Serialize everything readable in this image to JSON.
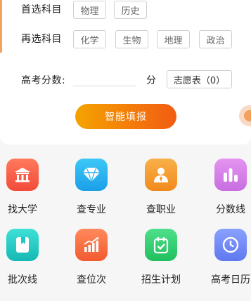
{
  "form": {
    "first_subject_label": "首选科目",
    "first_subject_options": [
      "物理",
      "历史"
    ],
    "second_subject_label": "再选科目",
    "second_subject_options": [
      "化学",
      "生物",
      "地理",
      "政治"
    ],
    "score_label": "高考分数:",
    "score_value": "",
    "score_unit": "分",
    "wishlist_label": "志愿表（0）",
    "submit_label": "智能填报"
  },
  "menu": {
    "items": [
      {
        "label": "找大学",
        "icon": "university-icon",
        "color": "#f55a4a"
      },
      {
        "label": "查专业",
        "icon": "diamond-icon",
        "color": "#28b6f0"
      },
      {
        "label": "查职业",
        "icon": "profession-icon",
        "color": "#f59a2e"
      },
      {
        "label": "分数线",
        "icon": "bar-chart-icon",
        "color": "#d67be8"
      },
      {
        "label": "批次线",
        "icon": "bookmark-icon",
        "color": "#1ec9c4"
      },
      {
        "label": "查位次",
        "icon": "rank-chart-icon",
        "color": "#f56b3d"
      },
      {
        "label": "招生计划",
        "icon": "calendar-check-icon",
        "color": "#2fcf6a"
      },
      {
        "label": "高考日历",
        "icon": "clock-icon",
        "color": "#6c86f5"
      }
    ]
  },
  "colors": {
    "accent_orange": "#f5a300",
    "accent_red_orange": "#f25c13",
    "background": "#f6f6f6"
  }
}
